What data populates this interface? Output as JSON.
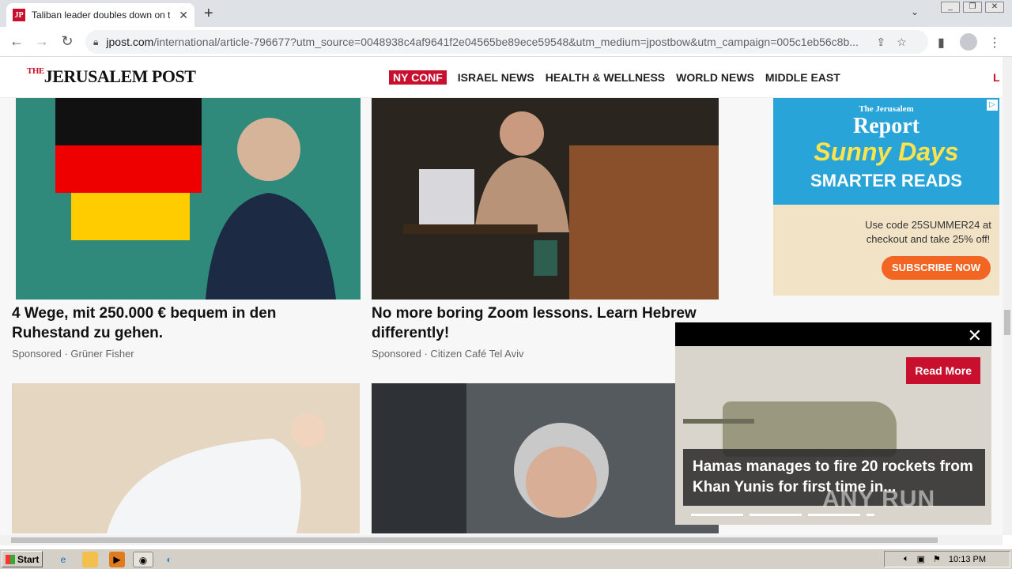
{
  "browser": {
    "tab_title": "Taliban leader doubles down on treat",
    "tab_favicon": "JP",
    "url_domain": "jpost.com",
    "url_path": "/international/article-796677?utm_source=0048938c4af9641f2e04565be89ece59548&utm_medium=jpostbow&utm_campaign=005c1eb56c8b..."
  },
  "site": {
    "logo_prefix": "THE",
    "logo_text": "JERUSALEM POST",
    "nav": [
      {
        "label": "NY CONF"
      },
      {
        "label": "ISRAEL NEWS"
      },
      {
        "label": "HEALTH & WELLNESS"
      },
      {
        "label": "WORLD NEWS"
      },
      {
        "label": "MIDDLE EAST"
      }
    ],
    "nav_more": "L"
  },
  "cards": [
    {
      "headline": "4 Wege, mit 250.000 € bequem in den Ruhestand zu gehen.",
      "sponsor": "Sponsored · Grüner Fisher"
    },
    {
      "headline": "No more boring Zoom lessons. Learn Hebrew differently!",
      "sponsor": "Sponsored · Citizen Café Tel Aviv"
    }
  ],
  "ad": {
    "brand_small": "The Jerusalem",
    "brand": "Report",
    "tagline": "Sunny Days",
    "subtag": "SMARTER READS",
    "promo": "Use code 25SUMMER24 at checkout and take 25% off!",
    "cta": "SUBSCRIBE NOW"
  },
  "video": {
    "read_more": "Read More",
    "caption": "Hamas manages to fire 20 rockets from Khan Yunis for first time in..."
  },
  "watermark": "ANY RUN",
  "taskbar": {
    "start": "Start",
    "time": "10:13 PM"
  }
}
